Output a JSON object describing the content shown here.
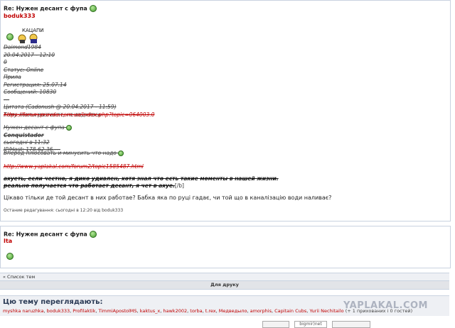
{
  "post1": {
    "title": "Re: Нужен десант с фупа",
    "author": "boduk333",
    "avatar_caption": "КАЦАПИ",
    "quote_lines": [
      "Daimond1984",
      "20.04.2017 - 12:10",
      "0",
      "Статус: Online",
      "Прила",
      "Регистрация: 25.07.14",
      "Сообщений: 10830",
      "---",
      "Цитата (Cadonush @ 20.04.2017 - 11:59)",
      "Тому хохлы разгонят, не водитось"
    ],
    "link1": "https://forum.pravda.com.ua/index.php?topic=064003.0",
    "nested_title": "Нужен десант с фупа",
    "nested_lines": [
      "Conquistador",
      "сьогодні в 11:32",
      "IP/Host: 178.62.36.---"
    ],
    "nested_tail": "Вперод плюсовать и минусить что надо",
    "link2": "http://www.yaplakal.com/forum2/topic1585487.html",
    "bold_line1": "ахуеть, если честно, я дико удивлен, хотя знал что есть такие моменты в нашей жизни.",
    "bold_line2": "реально получается что работает десант, я чет в ахуе.",
    "bold_tag": "[/b]",
    "body": "Цікаво тільки де той десант в них работае? Бабка яка по руці гадає, чи той що в каналізацію води наливає?",
    "edited": "Остание редагування: сьогодні в 12:20 від boduk333"
  },
  "post2": {
    "title": "Re: Нужен десант с фупа",
    "author": "Ita"
  },
  "nav": {
    "topic_list": "« Список тем",
    "print": "Для друку"
  },
  "viewers": {
    "heading": "Цю тему переглядають:",
    "names": [
      "myshka naruzhka",
      "boduk333",
      "Profilaktik",
      "TimmiApostolMS",
      "kaktus_x",
      "hawk2002",
      "torba",
      "t.rex",
      "Медведыло",
      "amorphis",
      "Capitain Cubs",
      "Yurii Nechitailo"
    ],
    "tail": "(+ 1 прихованих і 0 гостей)"
  },
  "watermark": "YAPLAKAL.COM",
  "footer": {
    "counter_label": "bigmir)net"
  }
}
